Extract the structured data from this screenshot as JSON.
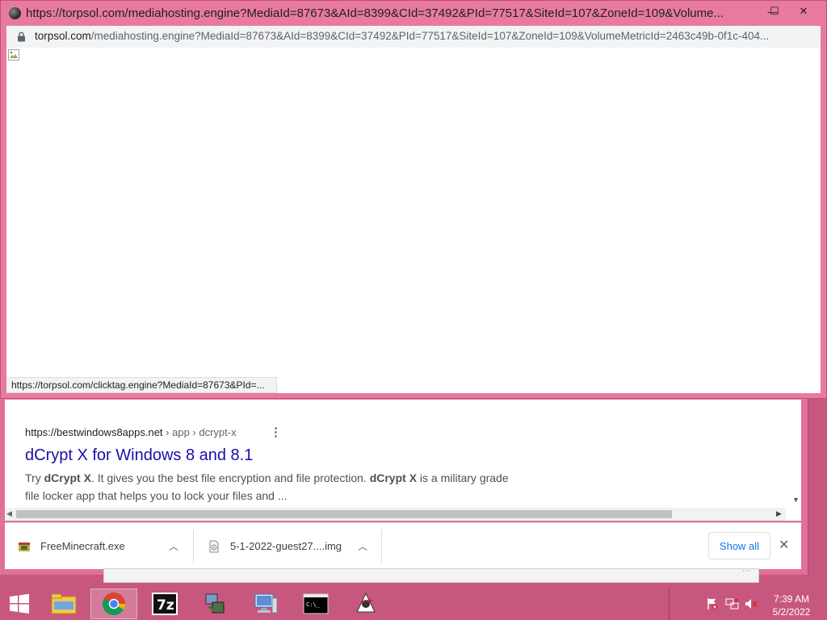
{
  "popup": {
    "title": "https://torpsol.com/mediahosting.engine?MediaId=87673&AId=8399&CId=37492&PId=77517&SiteId=107&ZoneId=109&Volume...",
    "address_host": "torpsol.com",
    "address_rest": "/mediahosting.engine?MediaId=87673&AId=8399&CId=37492&PId=77517&SiteId=107&ZoneId=109&VolumeMetricId=2463c49b-0f1c-404...",
    "status_link": "https://torpsol.com/clicktag.engine?MediaId=87673&PId=...",
    "minimize": "—",
    "maximize": "☐",
    "close": "✕"
  },
  "search_result": {
    "url": "https://bestwindows8apps.net",
    "breadcrumb": " › app › dcrypt-x",
    "title": "dCrypt X for Windows 8 and 8.1",
    "snippet_line1_a": "Try ",
    "snippet_line1_b": "dCrypt X",
    "snippet_line1_c": ". It gives you the best file encryption and file protection. ",
    "snippet_line1_d": "dCrypt X",
    "snippet_line1_e": " is a military grade",
    "snippet_line2": "file locker app that helps you to lock your files and ..."
  },
  "downloads": {
    "items": [
      {
        "name": "FreeMinecraft.exe"
      },
      {
        "name": "5-1-2022-guest27....img"
      }
    ],
    "show_all": "Show all",
    "close": "✕"
  },
  "taskbar": {
    "time": "7:39 AM",
    "date": "5/2/2022",
    "apps": [
      "start",
      "file-explorer",
      "chrome",
      "7zip",
      "network-tool",
      "computer",
      "command-prompt",
      "java-app"
    ]
  },
  "colors": {
    "window_frame": "#e87aa0",
    "taskbar": "#c8577f",
    "link_title": "#1a0dab",
    "show_all_text": "#1a73e8"
  }
}
